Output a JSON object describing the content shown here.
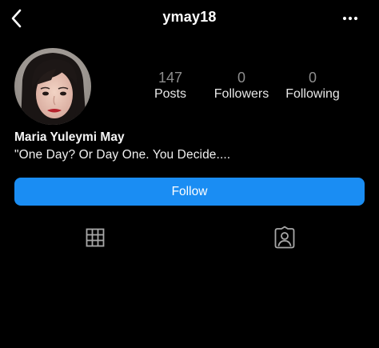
{
  "header": {
    "username": "ymay18",
    "back_icon": "chevron-left-icon",
    "more_icon": "more-horizontal-icon"
  },
  "profile": {
    "avatar_icon": "profile-photo",
    "stats": [
      {
        "value": "147",
        "label": "Posts"
      },
      {
        "value": "0",
        "label": "Followers"
      },
      {
        "value": "0",
        "label": "Following"
      }
    ],
    "full_name": "Maria Yuleymi May",
    "bio": "\"One Day? Or Day One. You Decide...."
  },
  "actions": {
    "follow_label": "Follow"
  },
  "tabs": {
    "grid_icon": "grid-icon",
    "tagged_icon": "tagged-user-icon"
  },
  "colors": {
    "background": "#000000",
    "accent": "#1a8df3",
    "icon": "#a8a8a8"
  }
}
